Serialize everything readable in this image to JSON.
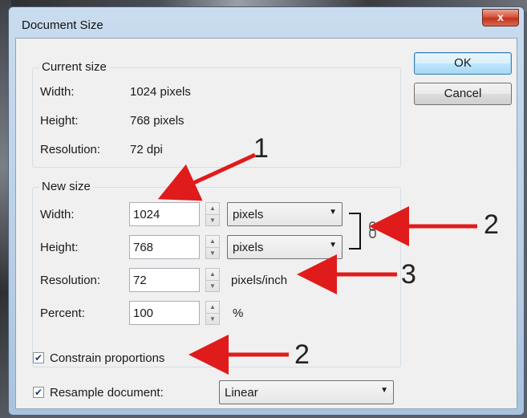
{
  "dialog": {
    "title": "Document Size",
    "close_label": "x",
    "ok_label": "OK",
    "cancel_label": "Cancel"
  },
  "current_size": {
    "title": "Current size",
    "width_label": "Width:",
    "width_value": "1024 pixels",
    "height_label": "Height:",
    "height_value": "768 pixels",
    "resolution_label": "Resolution:",
    "resolution_value": "72 dpi"
  },
  "new_size": {
    "title": "New size",
    "width_label": "Width:",
    "width_value": "1024",
    "width_unit": "pixels",
    "height_label": "Height:",
    "height_value": "768",
    "height_unit": "pixels",
    "resolution_label": "Resolution:",
    "resolution_value": "72",
    "resolution_unit": "pixels/inch",
    "percent_label": "Percent:",
    "percent_value": "100",
    "percent_unit": "%"
  },
  "options": {
    "constrain_label": "Constrain proportions",
    "constrain_checked": true,
    "resample_label": "Resample document:",
    "resample_checked": true,
    "resample_method": "Linear"
  },
  "annotations": {
    "one": "1",
    "two_link": "2",
    "three": "3",
    "two_constrain": "2",
    "color": "#e01b1b"
  }
}
